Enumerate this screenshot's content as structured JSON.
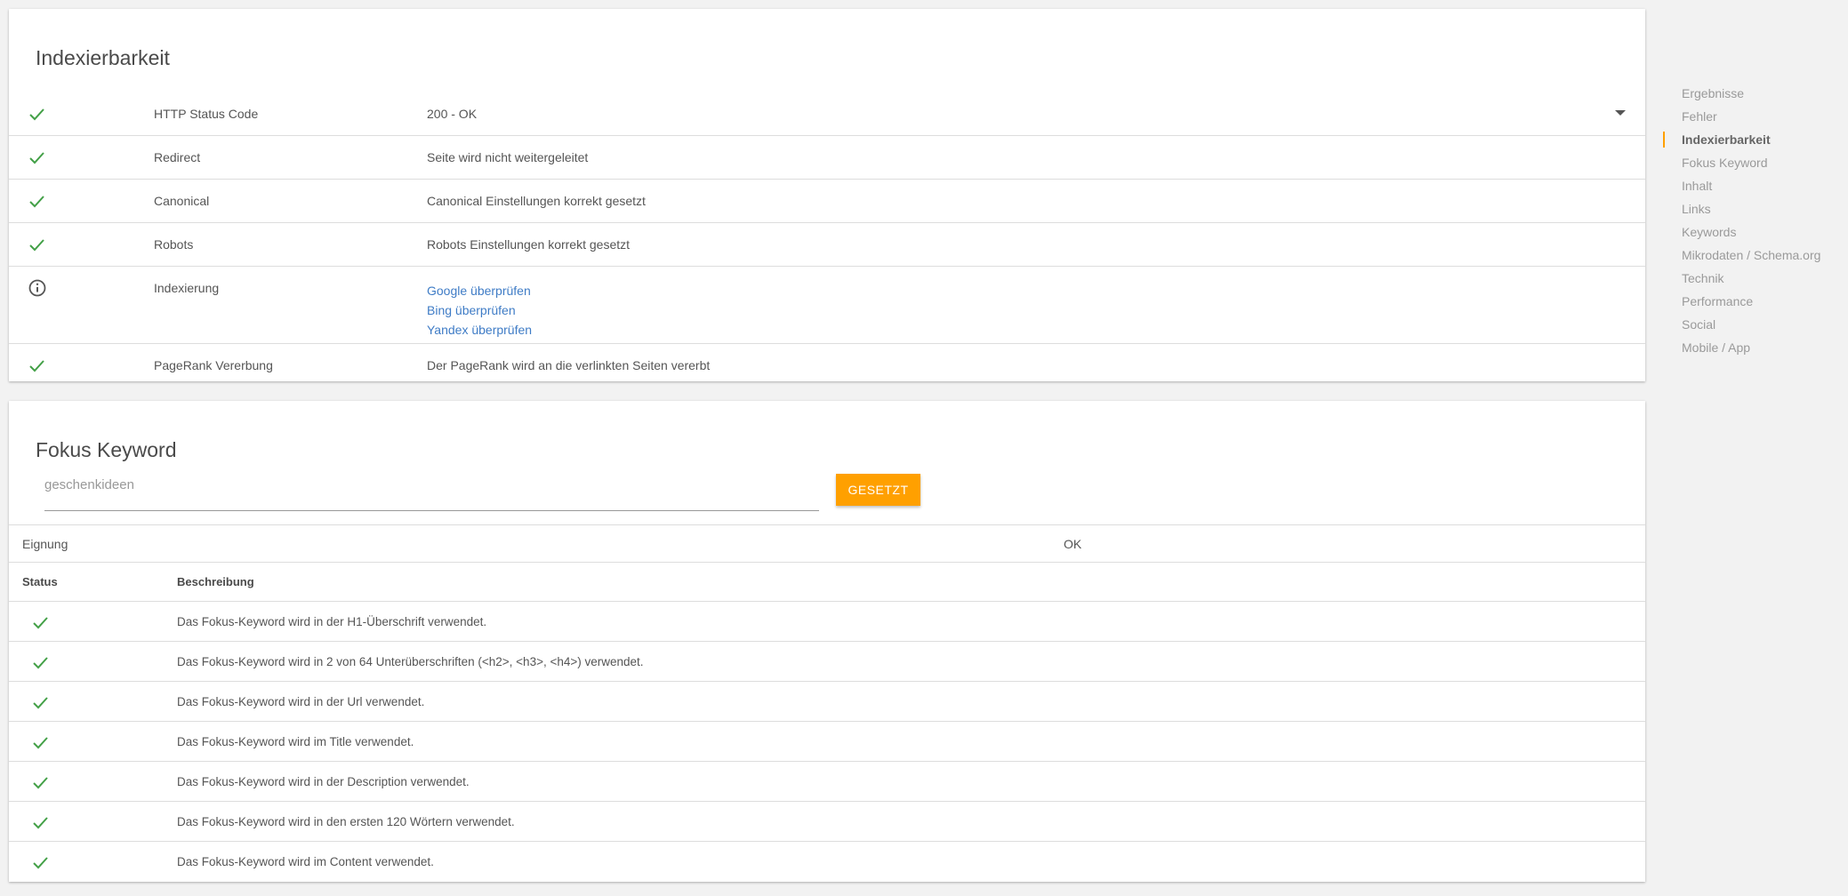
{
  "accent_color": "#ffa000",
  "check_color": "#43a047",
  "link_color": "#3f7cc6",
  "indexierbarkeit": {
    "title": "Indexierbarkeit",
    "rows": [
      {
        "icon": "check-icon",
        "label": "HTTP Status Code",
        "value": "200 - OK",
        "has_dropdown": true
      },
      {
        "icon": "check-icon",
        "label": "Redirect",
        "value": "Seite wird nicht weitergeleitet"
      },
      {
        "icon": "check-icon",
        "label": "Canonical",
        "value": "Canonical Einstellungen korrekt gesetzt"
      },
      {
        "icon": "check-icon",
        "label": "Robots",
        "value": "Robots Einstellungen korrekt gesetzt"
      },
      {
        "icon": "info-icon",
        "label": "Indexierung",
        "links": [
          "Google überprüfen",
          "Bing überprüfen",
          "Yandex überprüfen"
        ]
      },
      {
        "icon": "check-icon",
        "label": "PageRank Vererbung",
        "value": "Der PageRank wird an die verlinkten Seiten vererbt"
      }
    ]
  },
  "fokus_keyword": {
    "title": "Fokus Keyword",
    "input_value": "geschenkideen",
    "button_label": "GESETZT",
    "eignung_label": "Eignung",
    "eignung_value": "OK",
    "col_status": "Status",
    "col_description": "Beschreibung",
    "rows": [
      {
        "icon": "check-icon",
        "text": "Das Fokus-Keyword wird in der H1-Überschrift verwendet."
      },
      {
        "icon": "check-icon",
        "text": "Das Fokus-Keyword wird in 2 von 64 Unterüberschriften (<h2>, <h3>, <h4>) verwendet."
      },
      {
        "icon": "check-icon",
        "text": "Das Fokus-Keyword wird in der Url verwendet."
      },
      {
        "icon": "check-icon",
        "text": "Das Fokus-Keyword wird im Title verwendet."
      },
      {
        "icon": "check-icon",
        "text": "Das Fokus-Keyword wird in der Description verwendet."
      },
      {
        "icon": "check-icon",
        "text": "Das Fokus-Keyword wird in den ersten 120 Wörtern verwendet."
      },
      {
        "icon": "check-icon",
        "text": "Das Fokus-Keyword wird im Content verwendet."
      }
    ]
  },
  "side_nav": {
    "items": [
      "Ergebnisse",
      "Fehler",
      "Indexierbarkeit",
      "Fokus Keyword",
      "Inhalt",
      "Links",
      "Keywords",
      "Mikrodaten / Schema.org",
      "Technik",
      "Performance",
      "Social",
      "Mobile / App"
    ],
    "active": "Indexierbarkeit"
  }
}
